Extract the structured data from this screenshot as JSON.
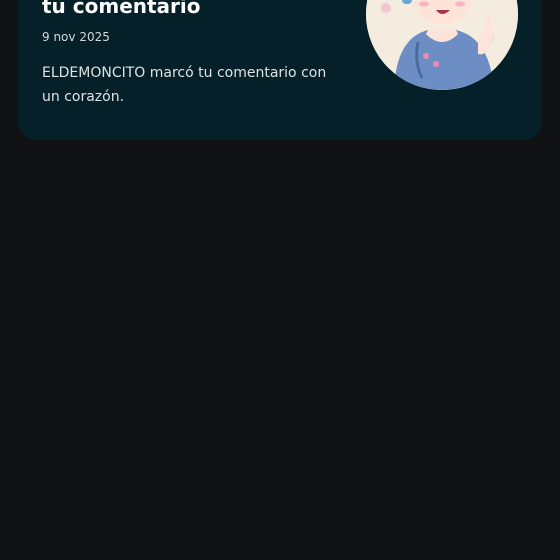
{
  "notification": {
    "title": "tu comentario",
    "date": "9 nov 2025",
    "message": "ELDEMONCITO marcó tu comentario con un corazón."
  },
  "avatar": {
    "icon": "user-avatar-anime-boy"
  },
  "colors": {
    "background": "#111214",
    "card": "#06202a",
    "text": "#ffffff"
  }
}
